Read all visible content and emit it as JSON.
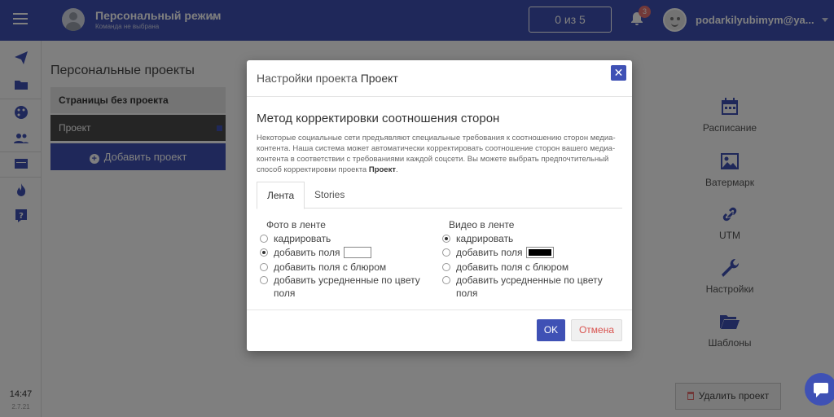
{
  "header": {
    "mode_title": "Персональный режим",
    "mode_subtitle": "Команда не выбрана",
    "counter": "0 из 5",
    "notifications_count": "3",
    "account_email": "podarkilyubimym@ya..."
  },
  "rail": {
    "icons": [
      "send-icon",
      "folder-icon",
      "palette-icon",
      "users-icon",
      "card-icon",
      "fire-icon",
      "help-icon"
    ],
    "time": "14:47",
    "version": "2.7.21"
  },
  "projects": {
    "title": "Персональные проекты",
    "group_label": "Страницы без проекта",
    "item_label": "Проект",
    "add_label": "Добавить проект"
  },
  "tools": [
    {
      "label": "Расписание",
      "icon": "calendar-icon"
    },
    {
      "label": "Ватермарк",
      "icon": "image-icon"
    },
    {
      "label": "UTM",
      "icon": "link-icon"
    },
    {
      "label": "Настройки",
      "icon": "wrench-icon"
    },
    {
      "label": "Шаблоны",
      "icon": "folder-open-icon"
    }
  ],
  "delete_label": "Удалить проект",
  "modal": {
    "title_prefix": "Настройки проекта",
    "title_project": "Проект",
    "section_title": "Метод корректировки соотношения сторон",
    "desc_main": "Некоторые социальные сети предъявляют специальные требования к соотношению сторон медиа-контента. Наша система может автоматически корректировать соотношение сторон вашего медиа-контента в соответствии с требованиями каждой соцсети. Вы можете выбрать предпочтительный способ корректировки проекта ",
    "desc_project": "Проект",
    "desc_end": ".",
    "tabs": [
      "Лента",
      "Stories"
    ],
    "photo": {
      "title": "Фото в ленте",
      "options": [
        "кадрировать",
        "добавить поля",
        "добавить поля с блюром",
        "добавить усредненные по цвету",
        "поля"
      ],
      "selected": "добавить поля",
      "swatch_color": "#ffffff"
    },
    "video": {
      "title": "Видео в ленте",
      "options": [
        "кадрировать",
        "добавить поля",
        "добавить поля с блюром",
        "добавить усредненные по цвету",
        "поля"
      ],
      "selected": "кадрировать",
      "swatch_color": "#000000"
    },
    "ok_label": "OK",
    "cancel_label": "Отмена"
  }
}
